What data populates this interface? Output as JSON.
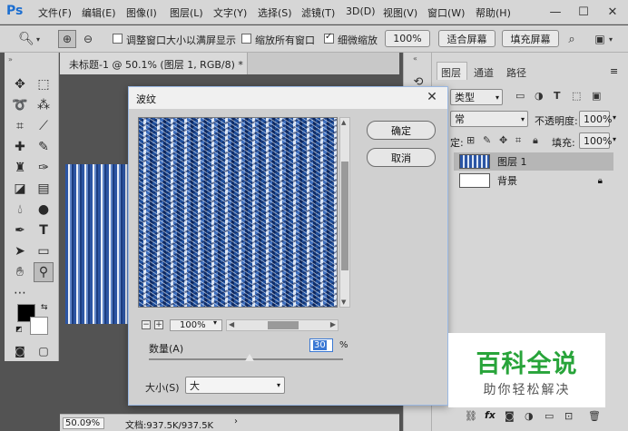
{
  "app": {
    "logo": "Ps"
  },
  "menu": [
    "文件(F)",
    "编辑(E)",
    "图像(I)",
    "图层(L)",
    "文字(Y)",
    "选择(S)",
    "滤镜(T)",
    "3D(D)",
    "视图(V)",
    "窗口(W)",
    "帮助(H)"
  ],
  "window_buttons": {
    "minimize": "—",
    "maximize": "☐",
    "close": "✕"
  },
  "options": {
    "resize_windows_label": "调整窗口大小以满屏显示",
    "zoom_all_label": "缩放所有窗口",
    "scrubby_zoom_label": "细微缩放",
    "zoom_100": "100%",
    "fit_screen": "适合屏幕",
    "fill_screen": "填充屏幕"
  },
  "document": {
    "tab_title": "未标题-1 @ 50.1% (图层 1, RGB/8) *",
    "zoom": "50.09%",
    "doc_size": "文档:937.5K/937.5K"
  },
  "layers_panel": {
    "tabs": [
      "图层",
      "通道",
      "路径"
    ],
    "filter_kind": "类型",
    "blend_mode": "常",
    "opacity_label": "不透明度:",
    "opacity_value": "100%",
    "lock_label": "定:",
    "fill_label": "填充:",
    "fill_value": "100%",
    "layers": [
      {
        "name": "图层 1"
      },
      {
        "name": "背景"
      }
    ],
    "bottom_icons": [
      "link-icon",
      "fx-icon",
      "mask-icon",
      "adjustment-icon",
      "group-icon",
      "new-layer-icon",
      "trash-icon"
    ],
    "fx_label": "fx"
  },
  "dialog": {
    "title": "波纹",
    "ok": "确定",
    "cancel": "取消",
    "zoom_value": "100%",
    "amount_label": "数量(A)",
    "amount_value": "30",
    "amount_unit": "%",
    "amount_slider_fraction": 0.52,
    "size_label": "大小(S)",
    "size_value": "大"
  },
  "watermark": {
    "main": "百科全说",
    "sub": "助你轻松解决"
  },
  "colors": {
    "accent": "#1c6ed0",
    "watermark_green": "#28a43a"
  }
}
